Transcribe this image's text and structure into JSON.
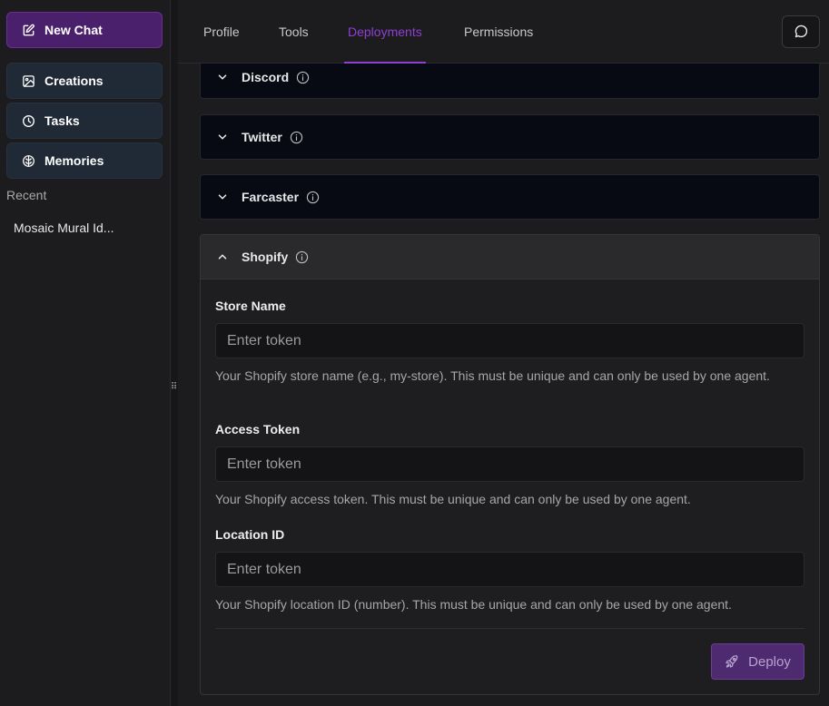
{
  "sidebar": {
    "new_chat_label": "New Chat",
    "nav": [
      {
        "label": "Creations",
        "icon": "image-icon"
      },
      {
        "label": "Tasks",
        "icon": "clock-icon"
      },
      {
        "label": "Memories",
        "icon": "brain-icon"
      }
    ],
    "recent_label": "Recent",
    "recent_items": [
      "Mosaic Mural Id..."
    ]
  },
  "header": {
    "tabs": [
      {
        "label": "Profile",
        "active": false
      },
      {
        "label": "Tools",
        "active": false
      },
      {
        "label": "Deployments",
        "active": true
      },
      {
        "label": "Permissions",
        "active": false
      }
    ]
  },
  "deployments": {
    "sections": [
      {
        "title": "Discord",
        "expanded": false
      },
      {
        "title": "Twitter",
        "expanded": false
      },
      {
        "title": "Farcaster",
        "expanded": false
      },
      {
        "title": "Shopify",
        "expanded": true
      }
    ],
    "shopify": {
      "fields": [
        {
          "label": "Store Name",
          "placeholder": "Enter token",
          "value": "",
          "help": "Your Shopify store name (e.g., my-store). This must be unique and can only be used by one agent."
        },
        {
          "label": "Access Token",
          "placeholder": "Enter token",
          "value": "",
          "help": "Your Shopify access token. This must be unique and can only be used by one agent."
        },
        {
          "label": "Location ID",
          "placeholder": "Enter token",
          "value": "",
          "help": "Your Shopify location ID (number). This must be unique and can only be used by one agent."
        }
      ],
      "deploy_label": "Deploy"
    }
  },
  "colors": {
    "accent": "#8e3fd1",
    "new_chat_bg": "#4a1f6b",
    "nav_bg": "#1f2a36",
    "deploy_bg": "#4e2a70"
  }
}
